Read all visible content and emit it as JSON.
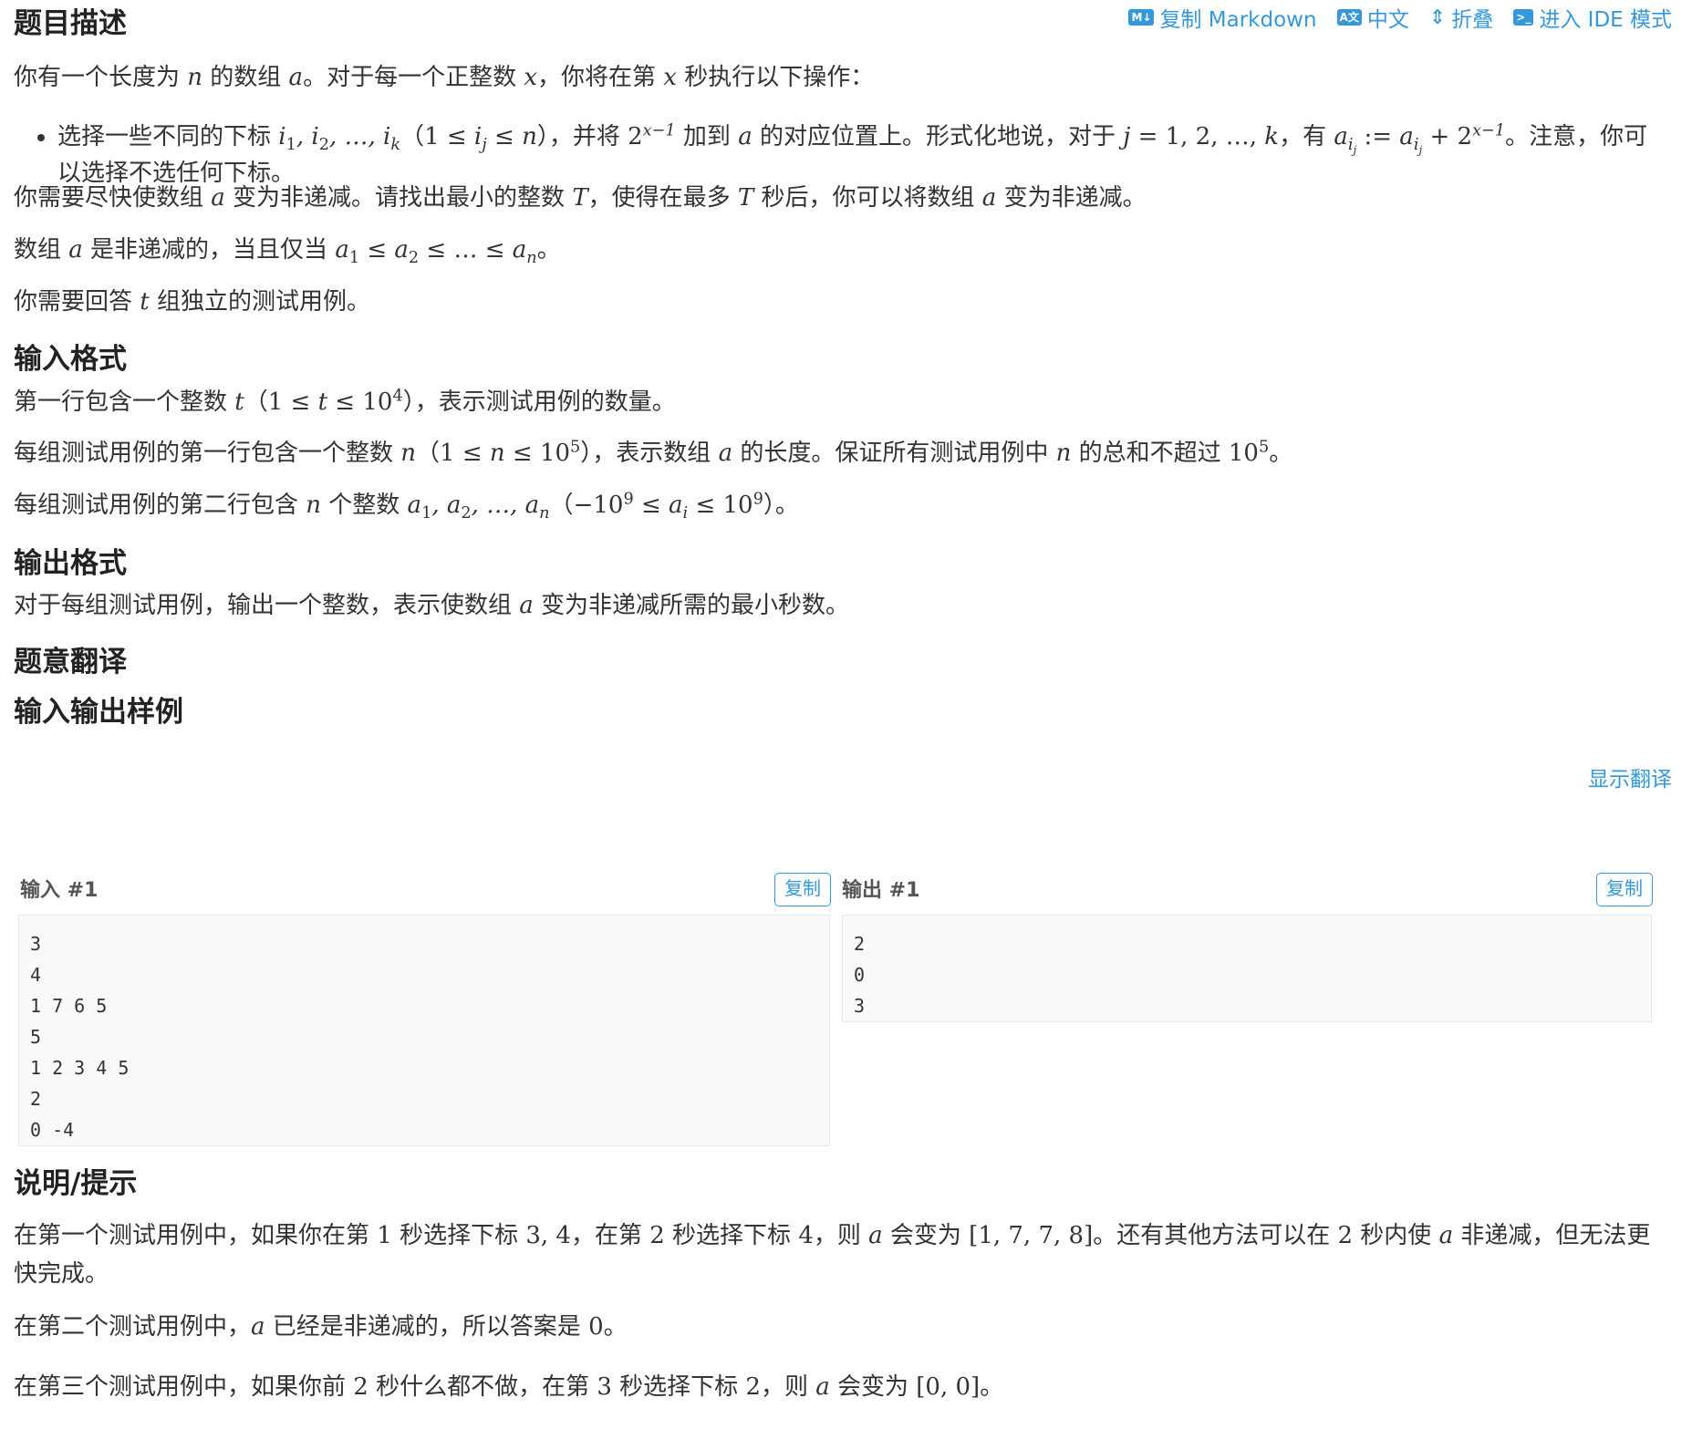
{
  "toolbar": {
    "copy_md_icon": "M↓",
    "copy_md": "复制 Markdown",
    "lang_icon": "A文",
    "lang": "中文",
    "fold": "折叠",
    "ide_icon": ">_",
    "ide": "进入 IDE 模式"
  },
  "headings": {
    "desc": "题目描述",
    "input": "输入格式",
    "output": "输出格式",
    "translation": "题意翻译",
    "samples": "输入输出样例",
    "notes": "说明/提示"
  },
  "show_translation": "显示翻译",
  "samples": {
    "input_title": "输入 #1",
    "output_title": "输出 #1",
    "copy_label": "复制",
    "input_text": "3\n4\n1 7 6 5\n5\n1 2 3 4 5\n2\n0 -4",
    "output_text": "2\n0\n3"
  }
}
